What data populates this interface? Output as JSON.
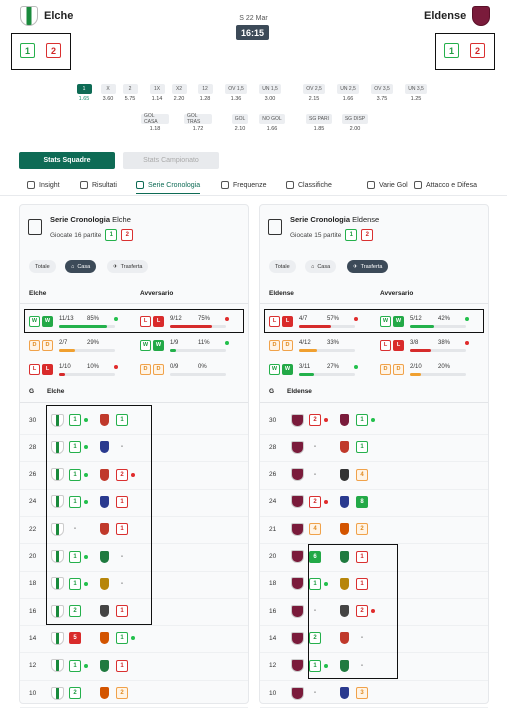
{
  "match": {
    "home": {
      "name": "Elche",
      "form": [
        "1",
        "2"
      ]
    },
    "away": {
      "name": "Eldense",
      "form": [
        "1",
        "2"
      ]
    },
    "date": "S 22 Mar",
    "time": "16:15"
  },
  "odds": [
    {
      "label": "1",
      "value": "1.65",
      "active": true
    },
    {
      "label": "X",
      "value": "3.60"
    },
    {
      "label": "2",
      "value": "5.75"
    },
    {
      "label": "1X",
      "value": "1.14"
    },
    {
      "label": "X2",
      "value": "2.20"
    },
    {
      "label": "12",
      "value": "1.28"
    },
    {
      "label": "OV 1,5",
      "value": "1.36"
    },
    {
      "label": "UN 1,5",
      "value": "3.00"
    },
    {
      "label": "OV 2,5",
      "value": "2.15"
    },
    {
      "label": "UN 2,5",
      "value": "1.66"
    },
    {
      "label": "OV 3,5",
      "value": "3.75"
    },
    {
      "label": "UN 3,5",
      "value": "1.25"
    },
    {
      "label": "GOL CASA",
      "value": "1.18"
    },
    {
      "label": "GOL TRAS",
      "value": "1.72"
    },
    {
      "label": "GOL",
      "value": "2.10"
    },
    {
      "label": "NO GOL",
      "value": "1.66"
    },
    {
      "label": "SG PARI",
      "value": "1.85"
    },
    {
      "label": "SG DISP",
      "value": "2.00"
    }
  ],
  "buttons": {
    "stats_teams": "Stats Squadre",
    "stats_league": "Stats Campionato"
  },
  "nav_tabs": [
    "Insight",
    "Risultati",
    "Serie Cronologia",
    "Frequenze",
    "Classifiche",
    "Varie Gol",
    "Attacco e Difesa"
  ],
  "colors": {
    "accent": "#0e6b55",
    "win": "#23a947",
    "loss": "#d92b2b",
    "draw": "#f0a24a"
  },
  "left_panel": {
    "title": "Serie Cronologia",
    "team": "Elche",
    "played": "Giocate 16 partite",
    "form": [
      "1",
      "2"
    ],
    "filters": [
      "Totale",
      "Casa",
      "Trasferta"
    ],
    "active_filter": "Casa",
    "col_team": "Elche",
    "col_opp": "Avversario",
    "streaks_team": [
      {
        "b": [
          "W",
          "W"
        ],
        "type": "w",
        "frac": "11/13",
        "pct": "85%",
        "fill": 0.85,
        "dot": "g"
      },
      {
        "b": [
          "D",
          "D"
        ],
        "type": "d",
        "frac": "2/7",
        "pct": "29%",
        "fill": 0.29,
        "dot": ""
      },
      {
        "b": [
          "L",
          "L"
        ],
        "type": "l",
        "frac": "1/10",
        "pct": "10%",
        "fill": 0.1,
        "dot": "r"
      }
    ],
    "streaks_opp": [
      {
        "b": [
          "L",
          "L"
        ],
        "type": "l",
        "frac": "9/12",
        "pct": "75%",
        "fill": 0.75,
        "dot": "r"
      },
      {
        "b": [
          "W",
          "W"
        ],
        "type": "w",
        "frac": "1/9",
        "pct": "11%",
        "fill": 0.11,
        "dot": "g"
      },
      {
        "b": [
          "D",
          "D"
        ],
        "type": "d",
        "frac": "0/9",
        "pct": "0%",
        "fill": 0,
        "dot": ""
      }
    ],
    "g_header": "G",
    "team_header": "Elche",
    "rows": [
      {
        "g": "30",
        "res": "1",
        "rc": "g",
        "dot": "g",
        "ores": "1",
        "oc": "g",
        "odot": ""
      },
      {
        "g": "28",
        "res": "1",
        "rc": "g",
        "dot": "g",
        "ores": "-",
        "oc": "",
        "odot": ""
      },
      {
        "g": "26",
        "res": "1",
        "rc": "g",
        "dot": "g",
        "ores": "2",
        "oc": "r",
        "odot": "r"
      },
      {
        "g": "24",
        "res": "1",
        "rc": "g",
        "dot": "g",
        "ores": "1",
        "oc": "r",
        "odot": ""
      },
      {
        "g": "22",
        "res": "-",
        "rc": "",
        "dot": "",
        "ores": "1",
        "oc": "r",
        "odot": ""
      },
      {
        "g": "20",
        "res": "1",
        "rc": "g",
        "dot": "g",
        "ores": "-",
        "oc": "",
        "odot": ""
      },
      {
        "g": "18",
        "res": "1",
        "rc": "g",
        "dot": "g",
        "ores": "-",
        "oc": "",
        "odot": ""
      },
      {
        "g": "16",
        "res": "2",
        "rc": "g",
        "dot": "",
        "ores": "1",
        "oc": "r",
        "odot": ""
      },
      {
        "g": "14",
        "res": "5",
        "rc": "rf",
        "dot": "",
        "ores": "1",
        "oc": "g",
        "odot": "g"
      },
      {
        "g": "12",
        "res": "1",
        "rc": "g",
        "dot": "g",
        "ores": "1",
        "oc": "r",
        "odot": ""
      },
      {
        "g": "10",
        "res": "2",
        "rc": "g",
        "dot": "",
        "ores": "2",
        "oc": "o",
        "odot": ""
      }
    ]
  },
  "right_panel": {
    "title": "Serie Cronologia",
    "team": "Eldense",
    "played": "Giocate 15 partite",
    "form": [
      "1",
      "2"
    ],
    "filters": [
      "Totale",
      "Casa",
      "Trasferta"
    ],
    "active_filter": "Trasferta",
    "col_team": "Eldense",
    "col_opp": "Avversario",
    "streaks_team": [
      {
        "b": [
          "L",
          "L"
        ],
        "type": "l",
        "frac": "4/7",
        "pct": "57%",
        "fill": 0.57,
        "dot": "r"
      },
      {
        "b": [
          "D",
          "D"
        ],
        "type": "d",
        "frac": "4/12",
        "pct": "33%",
        "fill": 0.33,
        "dot": ""
      },
      {
        "b": [
          "W",
          "W"
        ],
        "type": "w",
        "frac": "3/11",
        "pct": "27%",
        "fill": 0.27,
        "dot": "g"
      }
    ],
    "streaks_opp": [
      {
        "b": [
          "W",
          "W"
        ],
        "type": "w",
        "frac": "5/12",
        "pct": "42%",
        "fill": 0.42,
        "dot": "g"
      },
      {
        "b": [
          "L",
          "L"
        ],
        "type": "l",
        "frac": "3/8",
        "pct": "38%",
        "fill": 0.38,
        "dot": "r"
      },
      {
        "b": [
          "D",
          "D"
        ],
        "type": "d",
        "frac": "2/10",
        "pct": "20%",
        "fill": 0.2,
        "dot": ""
      }
    ],
    "g_header": "G",
    "team_header": "Eldense",
    "rows": [
      {
        "g": "30",
        "res": "2",
        "rc": "r",
        "dot": "r",
        "ores": "1",
        "oc": "g",
        "odot": "g"
      },
      {
        "g": "28",
        "res": "-",
        "rc": "",
        "dot": "",
        "ores": "1",
        "oc": "g",
        "odot": ""
      },
      {
        "g": "26",
        "res": "-",
        "rc": "",
        "dot": "",
        "ores": "4",
        "oc": "o",
        "odot": ""
      },
      {
        "g": "24",
        "res": "2",
        "rc": "r",
        "dot": "r",
        "ores": "8",
        "oc": "gf",
        "odot": ""
      },
      {
        "g": "21",
        "res": "4",
        "rc": "o",
        "dot": "",
        "ores": "2",
        "oc": "o",
        "odot": ""
      },
      {
        "g": "20",
        "res": "6",
        "rc": "gf",
        "dot": "",
        "ores": "1",
        "oc": "r",
        "odot": ""
      },
      {
        "g": "18",
        "res": "1",
        "rc": "g",
        "dot": "g",
        "ores": "1",
        "oc": "r",
        "odot": ""
      },
      {
        "g": "16",
        "res": "-",
        "rc": "",
        "dot": "",
        "ores": "2",
        "oc": "r",
        "odot": "r"
      },
      {
        "g": "14",
        "res": "2",
        "rc": "g",
        "dot": "",
        "ores": "-",
        "oc": "",
        "odot": ""
      },
      {
        "g": "12",
        "res": "1",
        "rc": "g",
        "dot": "g",
        "ores": "-",
        "oc": "",
        "odot": ""
      },
      {
        "g": "10",
        "res": "-",
        "rc": "",
        "dot": "",
        "ores": "3",
        "oc": "o",
        "odot": ""
      }
    ]
  }
}
